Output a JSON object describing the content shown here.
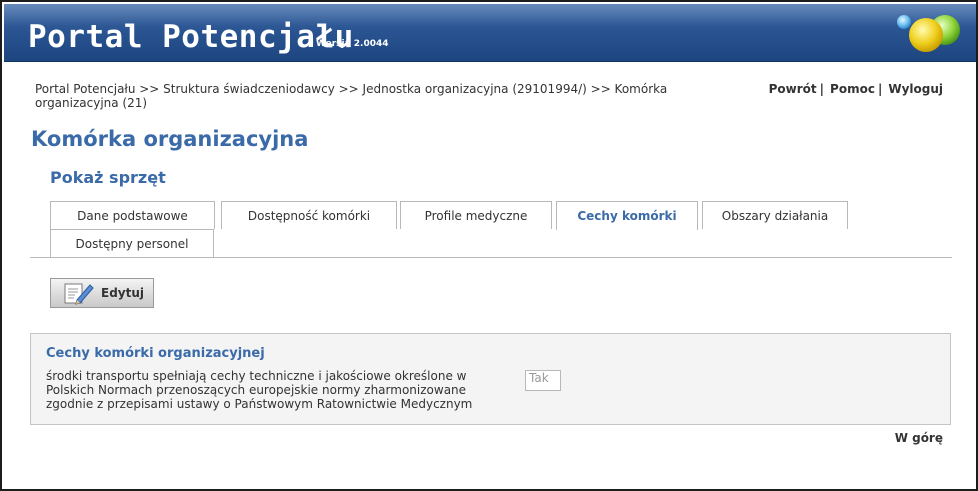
{
  "header": {
    "title": "Portal Potencjału",
    "version": "Wersja 2.0044"
  },
  "breadcrumb": {
    "text": "Portal Potencjału >> Struktura świadczeniodawcy >> Jednostka organizacyjna (29101994/) >> Komórka organizacyjna (21)"
  },
  "top_links": {
    "back": "Powrót",
    "help": "Pomoc",
    "logout": "Wyloguj",
    "separator": "|"
  },
  "page": {
    "title": "Komórka organizacyjna",
    "section_title": "Pokaż sprzęt"
  },
  "tabs": [
    {
      "label": "Dane podstawowe"
    },
    {
      "label": "Dostępność komórki"
    },
    {
      "label": "Profile medyczne"
    },
    {
      "label": "Cechy komórki",
      "active": true
    },
    {
      "label": "Obszary działania"
    },
    {
      "label": "Dostępny personel"
    }
  ],
  "toolbar": {
    "edit_label": "Edytuj",
    "edit_icon": "edit-pencil-icon"
  },
  "panel": {
    "title": "Cechy komórki organizacyjnej",
    "field_label": "środki transportu spełniają cechy techniczne i jakościowe określone w Polskich Normach przenoszących europejskie normy zharmonizowane zgodnie z przepisami ustawy o Państwowym Ratownictwie Medycznym",
    "field_value": "Tak"
  },
  "footer": {
    "scroll_top": "W górę"
  },
  "colors": {
    "header_blue": "#2a5592",
    "heading_blue": "#3a6aa8",
    "panel_bg": "#f4f4f4"
  }
}
